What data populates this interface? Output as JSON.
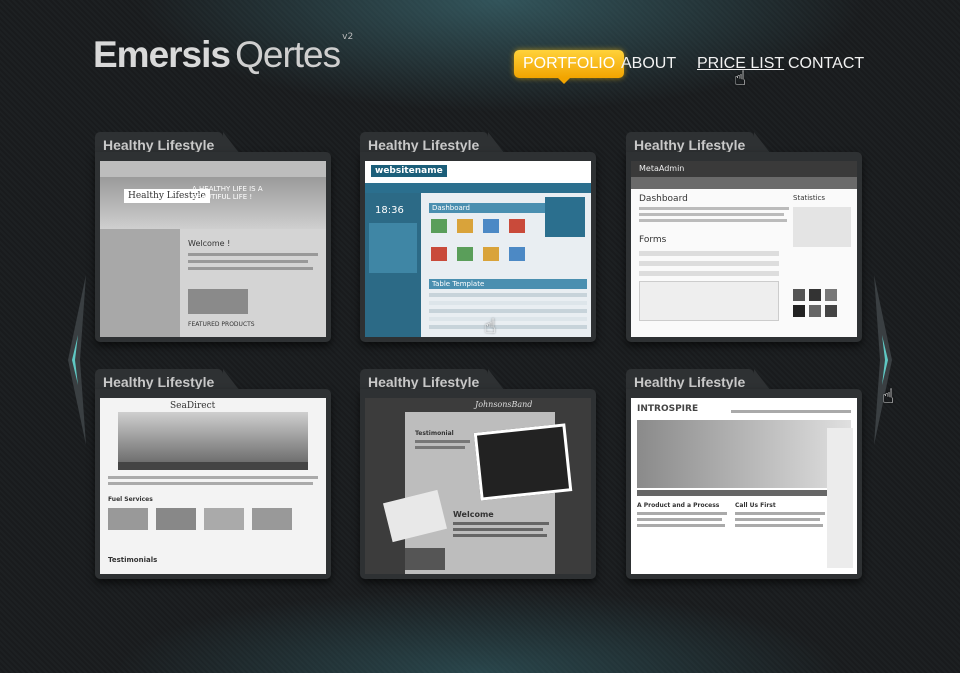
{
  "logo": {
    "word1": "Emersis",
    "word2": "Qertes",
    "version": "v2"
  },
  "nav": [
    {
      "label": "PORTFOLIO"
    },
    {
      "label": "ABOUT"
    },
    {
      "label": "PRICE LIST"
    },
    {
      "label": "CONTACT"
    }
  ],
  "cards": [
    {
      "tab": "Healthy Lifestyle",
      "shot_title": "A HEALTHY LIFE IS A BEAUTIFUL LIFE !",
      "shot_logo": "Healthy Lifestyle",
      "shot_heading": "Welcome !",
      "shot_sub": "FEATURED PRODUCTS"
    },
    {
      "tab": "Healthy Lifestyle",
      "shot_logo": "websitename",
      "shot_heading": "Dashboard",
      "shot_sub": "Table Template",
      "shot_clock": "18:36"
    },
    {
      "tab": "Healthy Lifestyle",
      "shot_logo": "MetaAdmin",
      "shot_heading": "Dashboard",
      "shot_sub": "Forms",
      "shot_side": "Statistics"
    },
    {
      "tab": "Healthy Lifestyle",
      "shot_logo": "SeaDirect",
      "shot_heading": "Fuel Services",
      "shot_sub": "Testimonials"
    },
    {
      "tab": "Healthy Lifestyle",
      "shot_logo": "JohnsonsBand",
      "shot_heading": "Testimonial",
      "shot_sub": "Welcome"
    },
    {
      "tab": "Healthy Lifestyle",
      "shot_logo": "INTROSPIRE",
      "shot_heading": "A Product and a Process",
      "shot_sub": "Call Us First"
    }
  ],
  "colors": {
    "accent": "#f5b100",
    "arrow": "#5fc9c4",
    "panel": "#2e3133"
  }
}
